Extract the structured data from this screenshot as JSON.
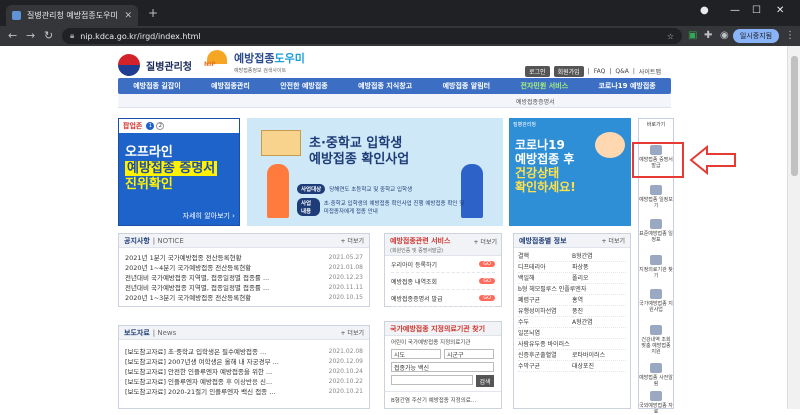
{
  "browser": {
    "tab_title": "질병관리청 예방접종도우미",
    "tab_close": "✕",
    "new_tab": "+",
    "url": "nip.kdca.go.kr/irgd/index.html",
    "pause_label": "일시중지됨",
    "win_min": "—",
    "win_max": "☐",
    "win_close": "✕"
  },
  "header": {
    "agency": "질병관리청",
    "site_title_a": "예방접종",
    "site_title_b": "도우미",
    "site_sub": "예방접종정보 검색사이트",
    "nip_letters": "NIP",
    "top_links": [
      "로그인",
      "회원가입",
      "FAQ",
      "Q&A",
      "사이트맵"
    ]
  },
  "gnb": [
    "예방접종 길잡이",
    "예방접종관리",
    "안전한 예방접종",
    "예방접종 지식창고",
    "예방접종 알림터",
    "전자민원 서비스",
    "코로나19 예방접종"
  ],
  "subgnb": "예방접종증명서",
  "popup": {
    "label": "팝업존",
    "dots": [
      "1",
      "2"
    ],
    "line1": "오프라인",
    "line2": "예방접종 증명서",
    "line3": "진위확인",
    "more": "자세히 알아보기 ›"
  },
  "banner": {
    "title1": "초·중학교 입학생",
    "title2": "예방접종 확인사업",
    "row1_tag": "사업대상",
    "row1_text": "당해연도 초등학교 및 중학교 입학생",
    "row2_tag": "사업내용",
    "row2_text": "초·중학교 입학생의 예방접종 확인사업 진행 예방접종 확인 및 미접종자에게 접종 안내"
  },
  "banner2": {
    "topline": "질병관리청",
    "l1": "코로나19",
    "l2": "예방접종 후",
    "l3": "건강상태",
    "l4": "확인하세요!"
  },
  "quick": {
    "head": "바로가기",
    "items": [
      "예방접종 증명서 발급",
      "예방접종 일정보기",
      "표준예방접종 일정표",
      "지정의료기관 찾기",
      "국가예방접종 지원사업",
      "건강내역 조회 맞춤 예방접종 지원",
      "예방접종 사전알림",
      "국외예방접종 자료"
    ]
  },
  "notice": {
    "title": "공지사항",
    "sub": "| NOTICE",
    "more": "+ 더보기",
    "items": [
      {
        "t": "2021년 1분기 국가예방접종 전산등록현황",
        "d": "2021.05.27"
      },
      {
        "t": "2020년 1~4분기 국가예방접종 전산등록현황",
        "d": "2021.01.08"
      },
      {
        "t": "전년대비 국가예방접종 지역별, 접종일정별 접종률 ...",
        "d": "2020.12.23"
      },
      {
        "t": "전년대비 국가예방접종 지역별, 접종일정별 접종률 ...",
        "d": "2020.11.11"
      },
      {
        "t": "2020년 1~3분기 국가예방접종 전산등록현황",
        "d": "2020.10.15"
      }
    ]
  },
  "press": {
    "title": "보도자료",
    "sub": "| News",
    "more": "+ 더보기",
    "items": [
      {
        "t": "[보도참고자료] 초·중학교 입학생은 필수예방접종 ...",
        "d": "2021.02.08"
      },
      {
        "t": "[보도참고자료] 2007년생 여학생은 올해 내 자궁경부 ...",
        "d": "2020.12.09"
      },
      {
        "t": "[보도참고자료] 안전한 인플루엔자 예방접종을 위한 ...",
        "d": "2020.10.24"
      },
      {
        "t": "[보도참고자료] 인플루엔자 예방접종 후 이상반응 신...",
        "d": "2020.10.22"
      },
      {
        "t": "[보도참고자료] 2020-21절기 인플루엔자 백신 접종 ...",
        "d": "2020.10.21"
      }
    ]
  },
  "service": {
    "title": "예방접종관련 서비스",
    "sub": "(회원인증 및 증명서발급)",
    "more": "+ 더보기",
    "go": "GO",
    "items": [
      "우리아이 등록하기",
      "예방접종 내역조회",
      "예방접종증명서 발급"
    ]
  },
  "clinic": {
    "title": "국가예방접종 지정의료기관 찾기",
    "sub": "어린이 국가예방접종 지정의료기관",
    "sido": "시도",
    "sigungu": "시군구",
    "vaccine": "접종가능 백신",
    "search": "검색",
    "foot": "B형간염 주산기 예방접종 지정의료..."
  },
  "disease": {
    "title": "예방접종별 정보",
    "more": "+ 더보기",
    "items": [
      "결핵",
      "B형간염",
      "디프테리아",
      "파상풍",
      "백일해",
      "폴리오",
      "b형 헤모필루스 인플루엔자",
      "",
      "폐렴구균",
      "홍역",
      "유행성이하선염",
      "풍진",
      "수두",
      "A형간염",
      "일본뇌염",
      "",
      "사람유두종 바이러스",
      "",
      "신증후군출혈열",
      "로타바이러스",
      "수막구균",
      "대상포진"
    ]
  }
}
